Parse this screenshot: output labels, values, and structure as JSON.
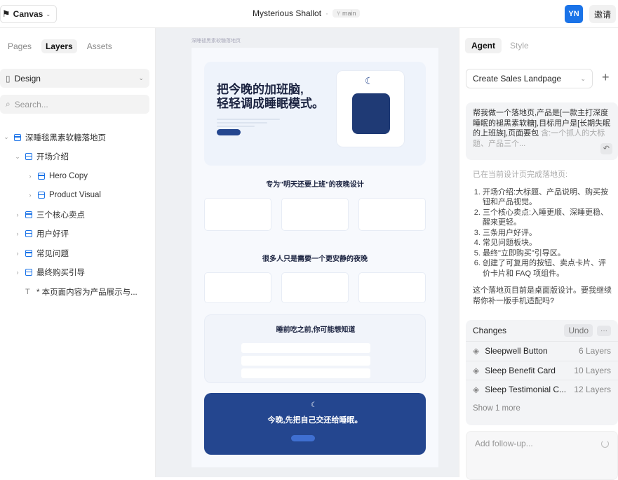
{
  "topbar": {
    "brand": "Canvas",
    "project": "Mysterious Shallot",
    "separator": "·",
    "branch": "main",
    "avatar": "YN",
    "invite": "邀请"
  },
  "left": {
    "tabs": [
      "Pages",
      "Layers",
      "Assets"
    ],
    "design": "Design",
    "search_placeholder": "Search...",
    "layers": [
      {
        "label": "深睡毯黑素软糖落地页",
        "depth": 0,
        "expanded": true,
        "icon": "frame-icon"
      },
      {
        "label": "开场介绍",
        "depth": 1,
        "expanded": true,
        "icon": "column-icon"
      },
      {
        "label": "Hero Copy",
        "depth": 2,
        "expanded": false,
        "icon": "frame-icon"
      },
      {
        "label": "Product Visual",
        "depth": 2,
        "expanded": false,
        "icon": "frame-icon"
      },
      {
        "label": "三个核心卖点",
        "depth": 1,
        "expanded": false,
        "icon": "frame-icon"
      },
      {
        "label": "用户好评",
        "depth": 1,
        "expanded": false,
        "icon": "frame-icon"
      },
      {
        "label": "常见问题",
        "depth": 1,
        "expanded": false,
        "icon": "frame-icon"
      },
      {
        "label": "最终购买引导",
        "depth": 1,
        "expanded": false,
        "icon": "frame-icon"
      },
      {
        "label": "* 本页面内容为产品展示与...",
        "depth": 1,
        "expanded": null,
        "icon": "text-icon"
      }
    ]
  },
  "canvas": {
    "frame_label": "深睡褪黑素软糖落地页",
    "hero_title_1": "把今晚的加班脑,",
    "hero_title_2": "轻轻调成睡眠模式。",
    "section1": "专为\"明天还要上班\"的夜晚设计",
    "section2": "很多人只是需要一个更安静的夜晚",
    "section3": "睡前吃之前,你可能想知道",
    "cta": "今晚,先把自己交还给睡眠。"
  },
  "right": {
    "tabs": [
      "Agent",
      "Style"
    ],
    "select": "Create Sales Landpage",
    "user_msg": "帮我做一个落地页,产品是[一款主打深度睡眠的褪黑素软糖],目标用户是[长期失眠的上班族],页面要包",
    "user_msg_fade": "含:一个抓人的大标题、产品三个...",
    "answer_intro": "已在当前设计页完成落地页:",
    "answer_items": [
      "开场介绍:大标题、产品说明、购买按钮和产品视觉。",
      "三个核心卖点:入睡更顺、深睡更稳、醒来更轻。",
      "三条用户好评。",
      "常见问题板块。",
      "最终\"立即购买\"引导区。",
      "创建了可复用的按钮、卖点卡片、评价卡片和 FAQ 项组件。"
    ],
    "answer_outro": "这个落地页目前是桌面版设计。要我继续帮你补一版手机适配吗?",
    "changes_title": "Changes",
    "undo": "Undo",
    "more": "···",
    "changes": [
      {
        "name": "Sleepwell Button",
        "count": "6 Layers"
      },
      {
        "name": "Sleep Benefit Card",
        "count": "10 Layers"
      },
      {
        "name": "Sleep Testimonial C...",
        "count": "12 Layers"
      }
    ],
    "show_more": "Show 1 more",
    "followup_placeholder": "Add follow-up..."
  }
}
